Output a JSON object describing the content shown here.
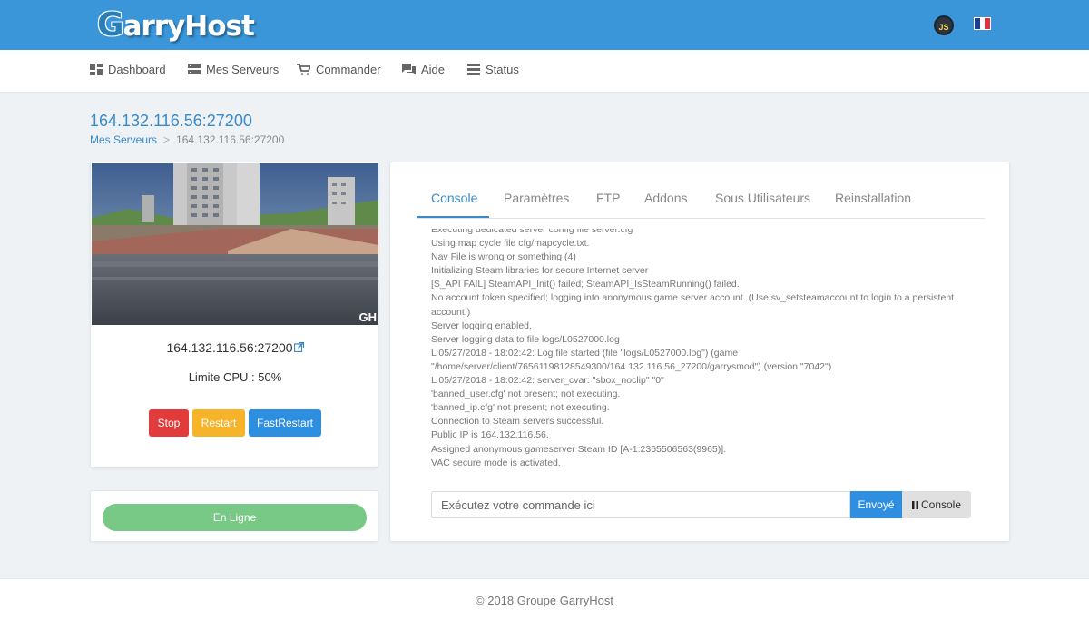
{
  "header": {
    "logo_first": "G",
    "logo_rest": "arryHost",
    "js_badge": "JS",
    "flag_colors": [
      "#1f3c8f",
      "#ffffff",
      "#e1313d"
    ]
  },
  "nav": [
    {
      "label": "Dashboard",
      "icon": "dashboard-icon"
    },
    {
      "label": "Mes Serveurs",
      "icon": "server-icon"
    },
    {
      "label": "Commander",
      "icon": "cart-icon"
    },
    {
      "label": "Aide",
      "icon": "chat-icon"
    },
    {
      "label": "Status",
      "icon": "status-icon"
    }
  ],
  "page": {
    "title": "164.132.116.56:27200",
    "breadcrumb": {
      "parent": "Mes Serveurs",
      "separator": ">",
      "current": "164.132.116.56:27200"
    }
  },
  "server": {
    "address": "164.132.116.56:27200",
    "cpu": "Limite CPU : 50%",
    "watermark": "GH",
    "buttons": {
      "stop": "Stop",
      "restart": "Restart",
      "fastrestart": "FastRestart"
    },
    "status": "En Ligne"
  },
  "tabs": [
    "Console",
    "Paramètres",
    "FTP",
    "Addons",
    "Sous Utilisateurs",
    "Reinstallation"
  ],
  "active_tab": "Console",
  "console": {
    "lines": [
      "Executing dedicated server config file server.cfg",
      "Using map cycle file cfg/mapcycle.txt.",
      "Nav File is wrong or something (4)",
      "Initializing Steam libraries for secure Internet server",
      "[S_API FAIL] SteamAPI_Init() failed; SteamAPI_IsSteamRunning() failed.",
      "No account token specified; logging into anonymous game server account. (Use sv_setsteamaccount to login to a persistent account.)",
      "Server logging enabled.",
      "Server logging data to file logs/L0527000.log",
      "L 05/27/2018 - 18:02:42: Log file started (file \"logs/L0527000.log\") (game \"/home/server/client/76561198128549300/164.132.116.56_27200/garrysmod\") (version \"7042\")",
      "L 05/27/2018 - 18:02:42: server_cvar: \"sbox_noclip\" \"0\"",
      "'banned_user.cfg' not present; not executing.",
      "'banned_ip.cfg' not present; not executing.",
      "Connection to Steam servers successful.",
      "Public IP is 164.132.116.56.",
      "Assigned anonymous gameserver Steam ID [A-1:2365506563(9965)].",
      "VAC secure mode is activated."
    ],
    "input_placeholder": "Exécutez votre commande ici",
    "send_label": "Envoyé",
    "console_label": "Console"
  },
  "footer": "© 2018 Groupe GarryHost"
}
